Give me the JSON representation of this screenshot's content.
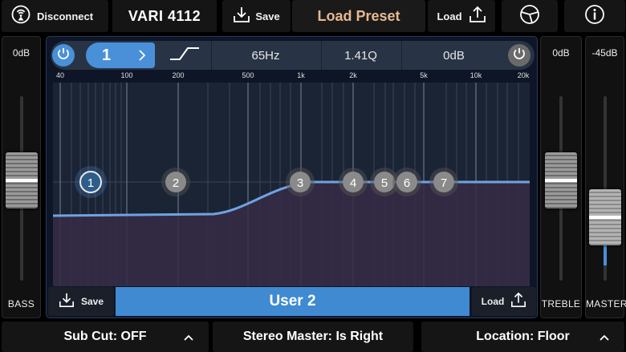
{
  "top": {
    "disconnect_label": "Disconnect",
    "device_name": "VARI 4112",
    "save_label": "Save",
    "load_preset_label": "Load Preset",
    "load_label": "Load"
  },
  "bass": {
    "value": "0dB",
    "label": "BASS"
  },
  "treble": {
    "value": "0dB",
    "label": "TREBLE"
  },
  "master": {
    "value": "-45dB",
    "label": "MASTER"
  },
  "band": {
    "number": "1",
    "frequency": "65Hz",
    "q": "1.41Q",
    "gain": "0dB"
  },
  "freq_axis": [
    "40",
    "100",
    "200",
    "500",
    "1k",
    "2k",
    "5k",
    "10k",
    "20k"
  ],
  "nodes": [
    "1",
    "2",
    "3",
    "4",
    "5",
    "6",
    "7"
  ],
  "preset": {
    "save_label": "Save",
    "name": "User 2",
    "load_label": "Load"
  },
  "bottom": {
    "subcut_label": "Sub Cut: OFF",
    "stereo_label": "Stereo Master: Is Right",
    "location_label": "Location: Floor"
  },
  "colors": {
    "accent": "#4a90d9",
    "preset_title": "#e8b890",
    "curve": "#6fa3e0"
  }
}
